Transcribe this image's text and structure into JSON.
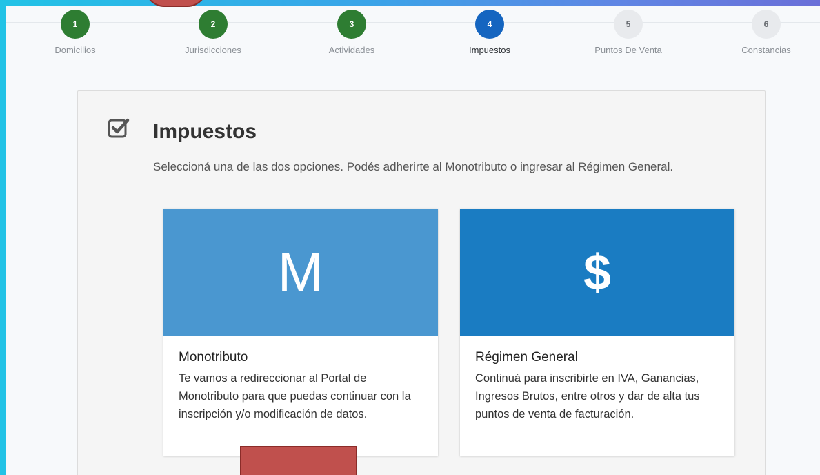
{
  "stepper": {
    "steps": [
      {
        "number": "1",
        "label": "Domicilios",
        "state": "done"
      },
      {
        "number": "2",
        "label": "Jurisdicciones",
        "state": "done"
      },
      {
        "number": "3",
        "label": "Actividades",
        "state": "done"
      },
      {
        "number": "4",
        "label": "Impuestos",
        "state": "active"
      },
      {
        "number": "5",
        "label": "Puntos De Venta",
        "state": "pending"
      },
      {
        "number": "6",
        "label": "Constancias",
        "state": "pending"
      }
    ]
  },
  "panel": {
    "icon": "checkbox-checked-icon",
    "title": "Impuestos",
    "description": "Seleccioná una de las dos opciones. Podés adherirte al Monotributo o ingresar al Régimen General."
  },
  "options": {
    "monotributo": {
      "symbol": "M",
      "title": "Monotributo",
      "text": "Te vamos a redireccionar al Portal de Monotributo para que puedas continuar con la inscripción y/o modificación de datos.",
      "color": "#4a97d0"
    },
    "regimen_general": {
      "symbol": "$",
      "title": "Régimen General",
      "text": "Continuá para inscribirte en IVA, Ganancias, Ingresos Brutos, entre otros y dar de alta tus puntos de venta de facturación.",
      "color": "#1a7cc2"
    }
  },
  "colors": {
    "step_done": "#2e7d32",
    "step_active": "#1565c0",
    "step_pending": "#e8eaed",
    "annotation_red": "#c0504d"
  }
}
